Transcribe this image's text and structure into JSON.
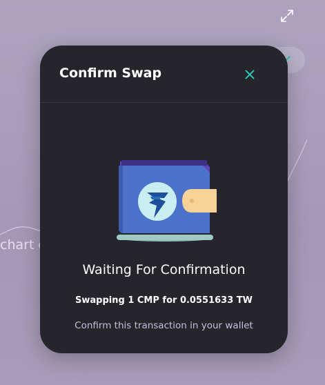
{
  "background": {
    "partial_text": "chart c",
    "icons": {
      "expand": "expand-icon",
      "chevron": "chevron-down-icon"
    }
  },
  "modal": {
    "title": "Confirm Swap",
    "close_icon": "close-icon",
    "illustration": "wallet-icon",
    "status_title": "Waiting For Confirmation",
    "swap_summary": "Swapping 1 CMP for 0.0551633 TW",
    "hint": "Confirm this transaction in your wallet"
  },
  "colors": {
    "modal_bg": "#25252b",
    "accent": "#2ec4b6",
    "backdrop": "#a99fbc"
  }
}
